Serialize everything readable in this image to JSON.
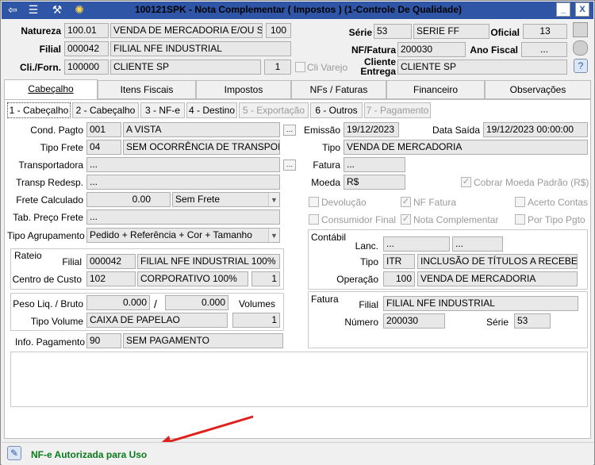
{
  "window": {
    "title": "100121SPK - Nota Complementar ( Impostos ) (1-Controle De Qualidade)",
    "close_glyph": "X",
    "min_glyph": "_"
  },
  "icons": {
    "back": "back-arrow-icon",
    "traffic": "traffic-light-icon",
    "wrench": "wrench-icon",
    "bulb": "lightbulb-icon",
    "help": "help-icon"
  },
  "header": {
    "natureza_label": "Natureza",
    "natureza_code": "100.01",
    "natureza_desc": "VENDA DE MERCADORIA E/OU SERVI",
    "natureza_num": "100",
    "filial_label": "Filial",
    "filial_code": "000042",
    "filial_desc": "FILIAL NFE INDUSTRIAL",
    "cli_label": "Cli./Forn.",
    "cli_code": "100000",
    "cli_desc": "CLIENTE SP",
    "cli_num": "1",
    "cli_varejo": "Cli Varejo",
    "serie_label": "Série",
    "serie_code": "53",
    "serie_desc": "SERIE FF",
    "oficial_label": "Oficial",
    "oficial_val": "13",
    "nf_label": "NF/Fatura",
    "nf_val": "200030",
    "ano_label": "Ano Fiscal",
    "ano_val": "...",
    "cliente_entrega_label1": "Cliente",
    "cliente_entrega_label2": "Entrega",
    "cliente_entrega_val": "CLIENTE SP"
  },
  "main_tabs": [
    "Cabeçalho",
    "Itens Fiscais",
    "Impostos",
    "NFs / Faturas",
    "Financeiro",
    "Observações"
  ],
  "sub_tabs": [
    "1 - Cabeçalho",
    "2 - Cabeçalho",
    "3 - NF-e",
    "4 - Destino",
    "5 - Exportação",
    "6 - Outros",
    "7 - Pagamento"
  ],
  "form": {
    "cond_pagto_label": "Cond. Pagto",
    "cond_pagto_code": "001",
    "cond_pagto_desc": "A VISTA",
    "tipo_frete_label": "Tipo Frete",
    "tipo_frete_code": "04",
    "tipo_frete_desc": "SEM OCORRÊNCIA DE TRANSPORTE",
    "transportadora_label": "Transportadora",
    "transportadora_val": "...",
    "transp_redesp_label": "Transp Redesp.",
    "transp_redesp_val": "...",
    "frete_calc_label": "Frete Calculado",
    "frete_calc_val": "0.00",
    "frete_calc_opt": "Sem Frete",
    "tab_preco_label": "Tab. Preço Frete",
    "tab_preco_val": "...",
    "tipo_agrup_label": "Tipo Agrupamento",
    "tipo_agrup_val": "Pedido + Referência + Cor + Tamanho",
    "emissao_label": "Emissão",
    "emissao_val": "19/12/2023",
    "data_saida_label": "Data Saída",
    "data_saida_val": "19/12/2023 00:00:00",
    "tipo_label": "Tipo",
    "tipo_val": "VENDA DE MERCADORIA",
    "fatura_label": "Fatura",
    "fatura_val": "...",
    "moeda_label": "Moeda",
    "moeda_val": "R$",
    "cobrar_moeda": "Cobrar Moeda Padrão (R$)",
    "devolucao": "Devolução",
    "nf_fatura": "NF Fatura",
    "acerto_contas": "Acerto Contas",
    "consumidor_final": "Consumidor Final",
    "nota_complementar": "Nota Complementar",
    "por_tipo_pgto": "Por Tipo Pgto"
  },
  "rateio": {
    "title": "Rateio",
    "filial_label": "Filial",
    "filial_code": "000042",
    "filial_desc": "FILIAL NFE INDUSTRIAL 100%",
    "cc_label": "Centro de Custo",
    "cc_code": "102",
    "cc_desc": "CORPORATIVO 100%",
    "cc_num": "1"
  },
  "contabil": {
    "title": "Contábil",
    "lanc_label": "Lanc.",
    "lanc_val1": "...",
    "lanc_val2": "...",
    "tipo_label": "Tipo",
    "tipo_code": "ITR",
    "tipo_desc": "INCLUSÃO DE TÍTULOS A RECEBER",
    "operacao_label": "Operação",
    "operacao_code": "100",
    "operacao_desc": "VENDA DE MERCADORIA"
  },
  "peso": {
    "label": "Peso Liq. / Bruto",
    "liq": "0.000",
    "sep": "/",
    "bruto": "0.000",
    "volumes_label": "Volumes",
    "tipo_volume_label": "Tipo Volume",
    "tipo_volume_val": "CAIXA DE PAPELAO",
    "volumes_val": "1"
  },
  "fatura_box": {
    "title": "Fatura",
    "filial_label": "Filial",
    "filial_val": "FILIAL NFE INDUSTRIAL",
    "numero_label": "Número",
    "numero_val": "200030",
    "serie_label": "Série",
    "serie_val": "53"
  },
  "info_pagamento": {
    "label": "Info. Pagamento",
    "code": "90",
    "desc": "SEM PAGAMENTO"
  },
  "status": {
    "text": "NF-e Autorizada para Uso",
    "color": "#0a7a1a"
  },
  "colors": {
    "title_bar": "#2e55a6",
    "arrow": "#e0201b"
  }
}
